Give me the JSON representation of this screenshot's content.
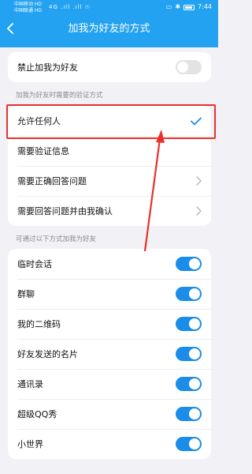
{
  "status_bar": {
    "carrier1": "中国移动 HD",
    "carrier2": "中国联通 HD",
    "signal": "4G .ıll .ıll ☉",
    "time": "7:44"
  },
  "header": {
    "title": "加我为好友的方式",
    "bg_color": "#22a2f0"
  },
  "block_all": {
    "label": "禁止加我为好友",
    "enabled": false
  },
  "verification": {
    "section_label": "加我为好友时需要的验证方式",
    "options": [
      {
        "label": "允许任何人",
        "selected": true
      },
      {
        "label": "需要验证信息",
        "selected": false
      },
      {
        "label": "需要正确回答问题",
        "selected": false
      },
      {
        "label": "需要回答问题并由我确认",
        "selected": false
      }
    ]
  },
  "methods": {
    "section_label": "可通过以下方式加我为好友",
    "items": [
      {
        "label": "临时会话",
        "enabled": true
      },
      {
        "label": "群聊",
        "enabled": true
      },
      {
        "label": "我的二维码",
        "enabled": true
      },
      {
        "label": "好友发送的名片",
        "enabled": true
      },
      {
        "label": "通讯录",
        "enabled": true
      },
      {
        "label": "超级QQ秀",
        "enabled": true
      },
      {
        "label": "小世界",
        "enabled": true
      }
    ]
  },
  "colors": {
    "accent": "#1b8de8",
    "annotation": "#e8302c"
  }
}
